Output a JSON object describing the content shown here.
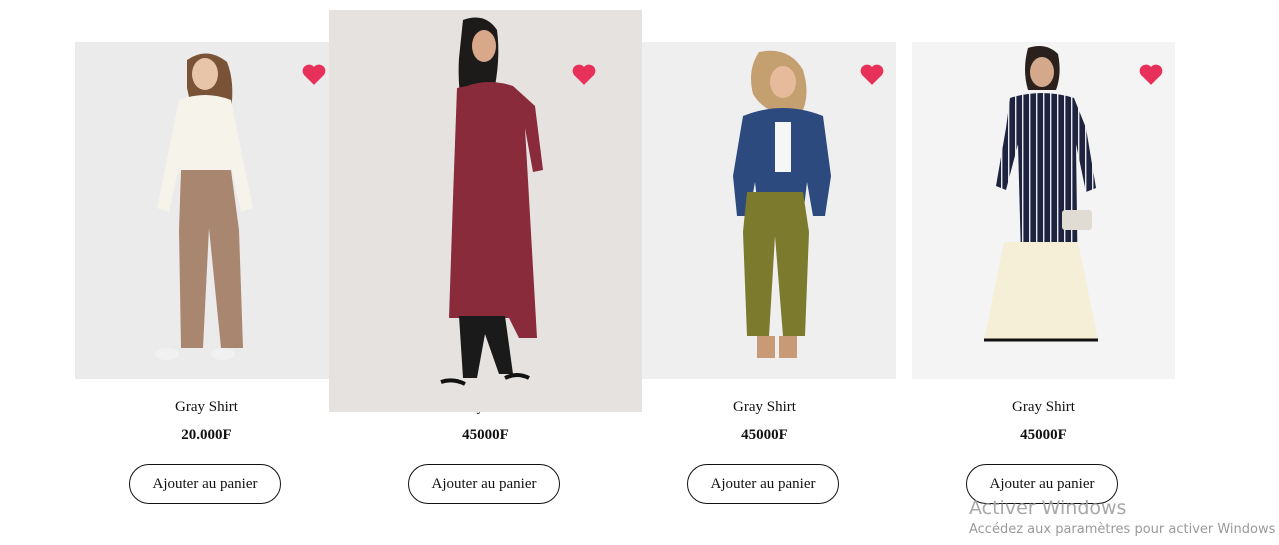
{
  "products": [
    {
      "name": "Gray Shirt",
      "price": "20.000F",
      "cta": "Ajouter au panier",
      "icon": "heart-icon",
      "favorite_color": "#e8315a",
      "photo_bg": "#ebebec"
    },
    {
      "name": "Gray Shirt",
      "price": "45000F",
      "cta": "Ajouter au panier",
      "icon": "heart-icon",
      "favorite_color": "#e8315a",
      "photo_bg": "#e6e2e0"
    },
    {
      "name": "Gray Shirt",
      "price": "45000F",
      "cta": "Ajouter au panier",
      "icon": "heart-icon",
      "favorite_color": "#e8315a",
      "photo_bg": "#efefef"
    },
    {
      "name": "Gray Shirt",
      "price": "45000F",
      "cta": "Ajouter au panier",
      "icon": "heart-icon",
      "favorite_color": "#e8315a",
      "photo_bg": "#f4f4f4"
    }
  ],
  "os_watermark": {
    "title": "Activer Windows",
    "subtitle": "Accédez aux paramètres pour activer Windows"
  }
}
